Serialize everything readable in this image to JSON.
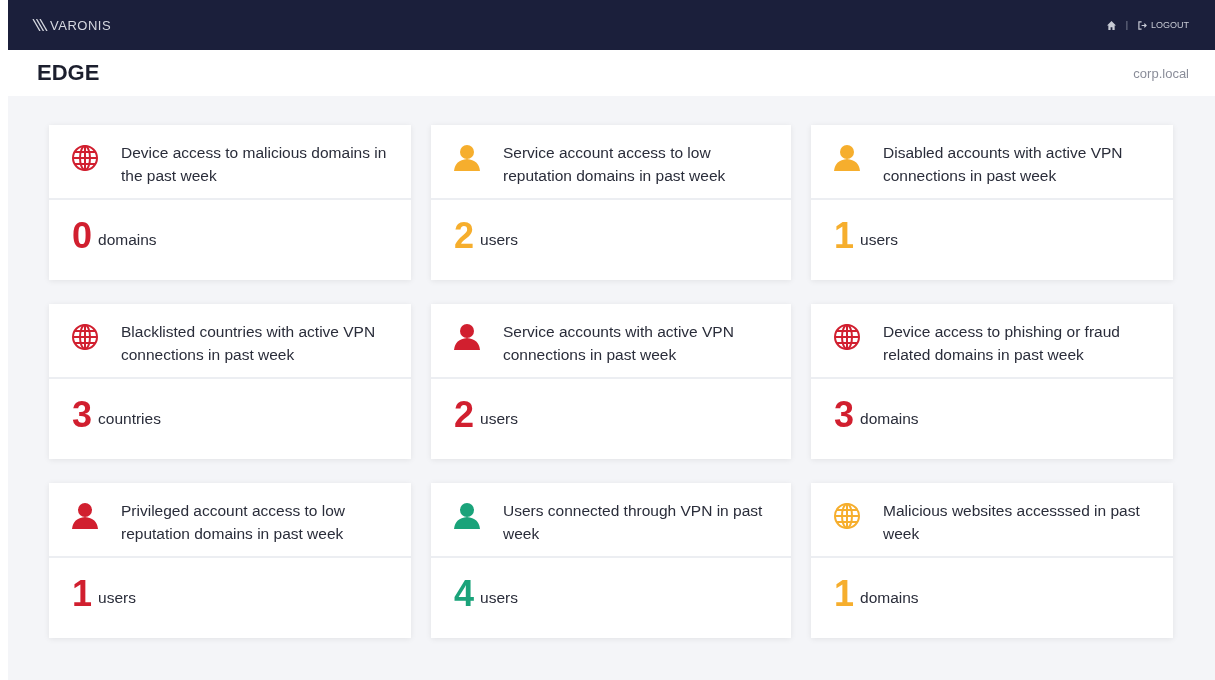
{
  "topbar": {
    "brand": "VARONIS",
    "separator": "|",
    "logout": "LOGOUT"
  },
  "header": {
    "title": "EDGE",
    "domain": "corp.local"
  },
  "cards": [
    {
      "kind": "globe",
      "color": "#d11f2f",
      "title": "Device access to malicious domains in the past week",
      "value": "0",
      "unit": "domains"
    },
    {
      "kind": "person",
      "color": "#f6ae2d",
      "title": "Service account access to low reputation domains in past week",
      "value": "2",
      "unit": "users"
    },
    {
      "kind": "person",
      "color": "#f6ae2d",
      "title": "Disabled accounts with active VPN connections in past week",
      "value": "1",
      "unit": "users"
    },
    {
      "kind": "globe",
      "color": "#d11f2f",
      "title": "Blacklisted countries with active VPN connections in past week",
      "value": "3",
      "unit": "countries"
    },
    {
      "kind": "person",
      "color": "#d11f2f",
      "title": "Service accounts with active VPN connections in past week",
      "value": "2",
      "unit": "users"
    },
    {
      "kind": "globe",
      "color": "#d11f2f",
      "title": "Device access to phishing or fraud related domains in past week",
      "value": "3",
      "unit": "domains"
    },
    {
      "kind": "person",
      "color": "#d11f2f",
      "title": "Privileged account access to low reputation domains in past week",
      "value": "1",
      "unit": "users"
    },
    {
      "kind": "person",
      "color": "#1aa37a",
      "title": "Users connected through VPN in past week",
      "value": "4",
      "unit": "users"
    },
    {
      "kind": "globe",
      "color": "#f6ae2d",
      "title": "Malicious websites accesssed in past week",
      "value": "1",
      "unit": "domains"
    }
  ]
}
